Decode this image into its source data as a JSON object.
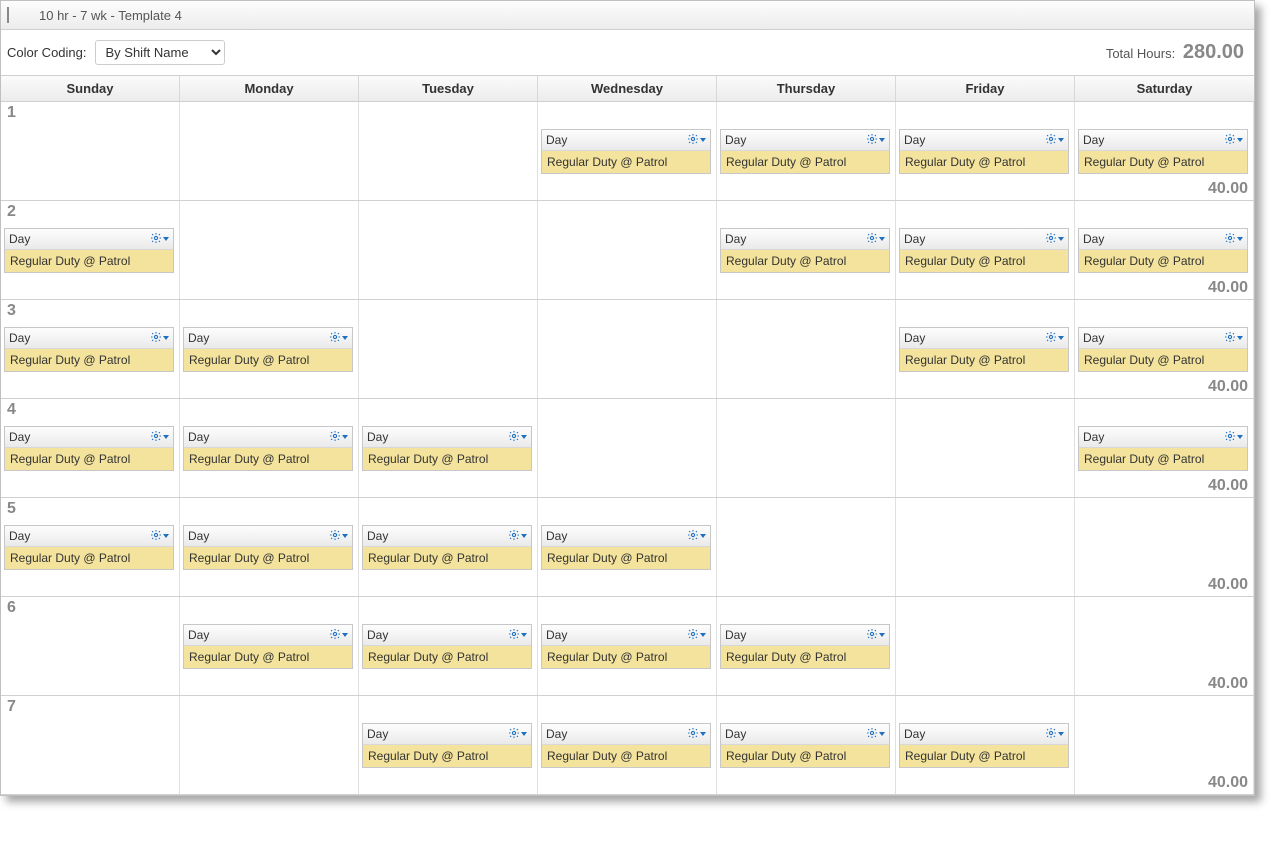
{
  "title": "10 hr - 7 wk - Template 4",
  "toolbar": {
    "color_coding_label": "Color Coding:",
    "color_coding_value": "By Shift Name",
    "total_hours_label": "Total Hours:",
    "total_hours_value": "280.00"
  },
  "weekdays": [
    "Sunday",
    "Monday",
    "Tuesday",
    "Wednesday",
    "Thursday",
    "Friday",
    "Saturday"
  ],
  "shift_card": {
    "name": "Day",
    "detail": "Regular Duty @ Patrol"
  },
  "rows": [
    {
      "week": "1",
      "total": "40.00",
      "days": [
        false,
        false,
        false,
        true,
        true,
        true,
        true
      ]
    },
    {
      "week": "2",
      "total": "40.00",
      "days": [
        true,
        false,
        false,
        false,
        true,
        true,
        true
      ]
    },
    {
      "week": "3",
      "total": "40.00",
      "days": [
        true,
        true,
        false,
        false,
        false,
        true,
        true
      ]
    },
    {
      "week": "4",
      "total": "40.00",
      "days": [
        true,
        true,
        true,
        false,
        false,
        false,
        true
      ]
    },
    {
      "week": "5",
      "total": "40.00",
      "days": [
        true,
        true,
        true,
        true,
        false,
        false,
        false
      ]
    },
    {
      "week": "6",
      "total": "40.00",
      "days": [
        false,
        true,
        true,
        true,
        true,
        false,
        false
      ]
    },
    {
      "week": "7",
      "total": "40.00",
      "days": [
        false,
        false,
        true,
        true,
        true,
        true,
        false
      ]
    }
  ]
}
